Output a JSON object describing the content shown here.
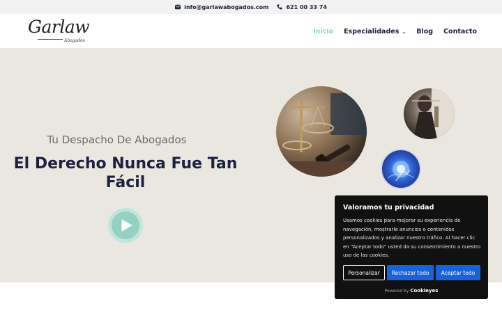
{
  "topbar": {
    "email": "info@garlawabogados.com",
    "phone": "621 00 33 74",
    "email_icon": "envelope-icon",
    "phone_icon": "phone-icon"
  },
  "logo": {
    "script": "Garlaw",
    "sub": "Abogados"
  },
  "nav": {
    "items": [
      {
        "label": "Inicio",
        "active": true
      },
      {
        "label": "Especialidades",
        "has_dropdown": true
      },
      {
        "label": "Blog"
      },
      {
        "label": "Contacto"
      }
    ],
    "dropdown_icon": "chevron-down-icon"
  },
  "hero": {
    "subtitle": "Tu Despacho De Abogados",
    "title": "El Derecho Nunca Fue Tan Fácil",
    "play_icon": "play-icon"
  },
  "images": [
    "scales-of-justice-photo",
    "lady-justice-photo",
    "digital-law-photo"
  ],
  "cookie": {
    "title": "Valoramos tu privacidad",
    "text": "Usamos cookies para mejorar su experiencia de navegación, mostrarle anuncios o contenidos personalizados y analizar nuestro tráfico. Al hacer clic en “Aceptar todo” usted da su consentimiento a nuestro uso de las cookies.",
    "btn_customize": "Personalizar",
    "btn_reject": "Rechazar todo",
    "btn_accept": "Aceptar todo",
    "powered_by": "Powered by",
    "powered_brand": "Cookieyes"
  },
  "colors": {
    "accent": "#8fd3c7",
    "navy": "#1b2240",
    "hero_bg": "#eae7e1",
    "cookie_button": "#1863dc"
  }
}
